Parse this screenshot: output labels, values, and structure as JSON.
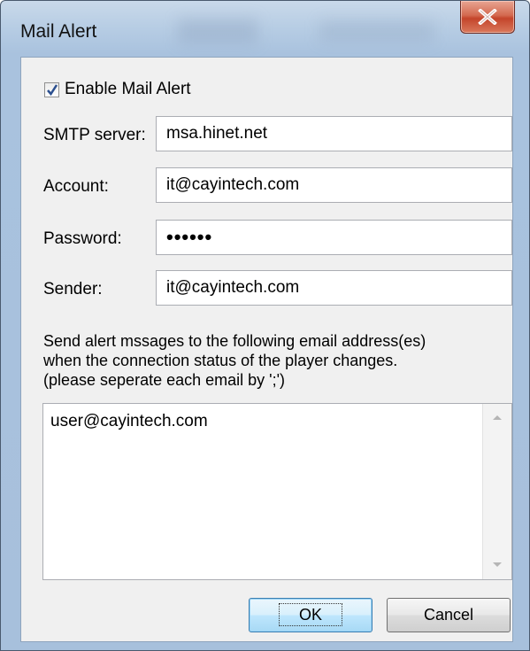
{
  "window": {
    "title": "Mail Alert"
  },
  "enable_mail_alert": {
    "label": "Enable Mail Alert",
    "checked": true
  },
  "smtp_server": {
    "label": "SMTP server:",
    "value": "msa.hinet.net"
  },
  "account": {
    "label": "Account:",
    "value": "it@cayintech.com"
  },
  "password": {
    "label": "Password:",
    "value": "••••••"
  },
  "sender": {
    "label": "Sender:",
    "value": "it@cayintech.com"
  },
  "instructions": {
    "line1": "Send alert mssages to the following email address(es)",
    "line2": "when the connection status of the player changes.",
    "line3": "(please seperate each email by ';')"
  },
  "recipients": {
    "value": "user@cayintech.com"
  },
  "buttons": {
    "ok": "OK",
    "cancel": "Cancel"
  },
  "icons": {
    "close": "close-icon",
    "checkmark": "checkmark-icon",
    "scroll_up": "scroll-up-arrow-icon",
    "scroll_down": "scroll-down-arrow-icon"
  }
}
